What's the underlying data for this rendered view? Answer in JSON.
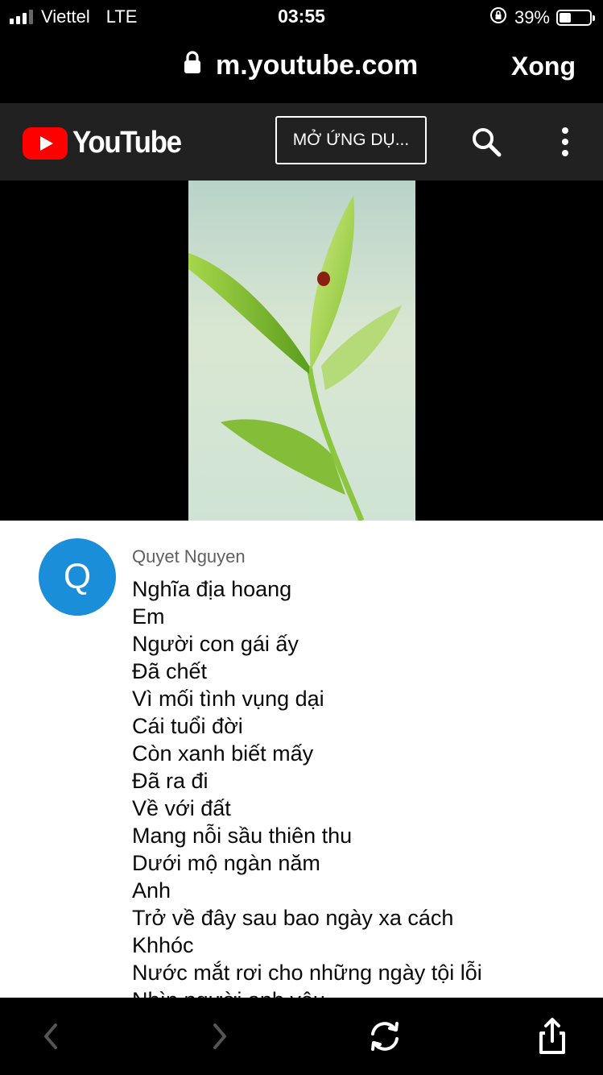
{
  "status_bar": {
    "carrier": "Viettel",
    "network": "LTE",
    "time": "03:55",
    "battery_percent": "39%",
    "battery_level": 0.39
  },
  "browser": {
    "url": "m.youtube.com",
    "done_label": "Xong"
  },
  "youtube_header": {
    "logo_text": "YouTube",
    "open_app_label": "MỞ ỨNG DỤ...",
    "logo_color": "#ff0000"
  },
  "comment": {
    "avatar_letter": "Q",
    "avatar_color": "#1a8ed9",
    "author": "Quyet Nguyen",
    "lines": [
      "Nghĩa địa hoang",
      "Em",
      "Người con gái ấy",
      "Đã chết",
      "Vì mối tình vụng dại",
      "Cái tuổi đời",
      "Còn xanh biết mấy",
      "Đã ra đi",
      "Về với đất",
      "Mang nỗi sầu thiên thu",
      "Dưới mộ ngàn năm",
      "Anh",
      "Trở về đây sau bao ngày xa cách",
      "Khhóc",
      "Nước mắt rơi cho những ngày tội lỗi",
      "Nhìn người anh yêu"
    ]
  },
  "toolbar": {
    "icons": [
      "back-icon",
      "forward-icon",
      "reload-icon",
      "share-icon"
    ]
  }
}
